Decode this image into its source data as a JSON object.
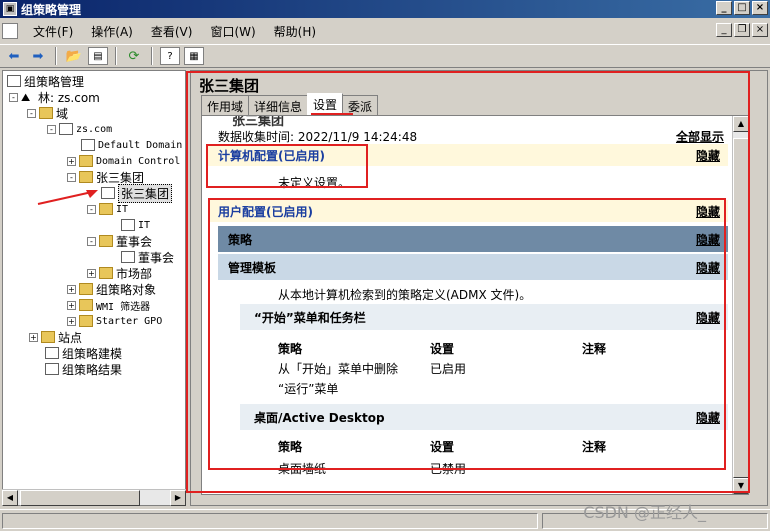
{
  "window": {
    "title": "组策略管理"
  },
  "menu": [
    "文件(F)",
    "操作(A)",
    "查看(V)",
    "窗口(W)",
    "帮助(H)"
  ],
  "tree": {
    "root": "组策略管理",
    "forest": "林: zs.com",
    "domains": "域",
    "domain": "zs.com",
    "ddp": "Default Domain",
    "ddc": "Domain Control",
    "ou_zs": "张三集团",
    "gpo_selected": "张三集团",
    "ou_it": "IT",
    "gpo_it": "IT",
    "ou_board": "董事会",
    "gpo_board": "董事会",
    "ou_market": "市场部",
    "gpo_objects": "组策略对象",
    "wmi": "WMI 筛选器",
    "starter": "Starter GPO",
    "sites": "站点",
    "modeling": "组策略建模",
    "results": "组策略结果"
  },
  "right": {
    "title": "张三集团",
    "tabs": [
      "作用域",
      "详细信息",
      "设置",
      "委派"
    ],
    "active_tab": "设置",
    "cutoff_title": "张三集团",
    "collected": "数据收集时间: 2022/11/9 14:24:48",
    "show_all": "全部显示",
    "hide": "隐藏",
    "computer_config": "计算机配置(已启用)",
    "no_settings": "未定义设置。",
    "user_config": "用户配置(已启用)",
    "policies": "策略",
    "admin_templates": "管理模板",
    "admx_note": "从本地计算机检索到的策略定义(ADMX 文件)。",
    "start_menu": "“开始”菜单和任务栏",
    "col_policy": "策略",
    "col_setting": "设置",
    "col_comment": "注释",
    "row1_policy_a": "从「开始」菜单中删除",
    "row1_policy_b": "“运行”菜单",
    "row1_setting": "已启用",
    "desktop": "桌面/Active Desktop",
    "row2_policy": "桌面墙纸",
    "row2_setting": "已禁用"
  },
  "watermark": "CSDN @正经人_"
}
